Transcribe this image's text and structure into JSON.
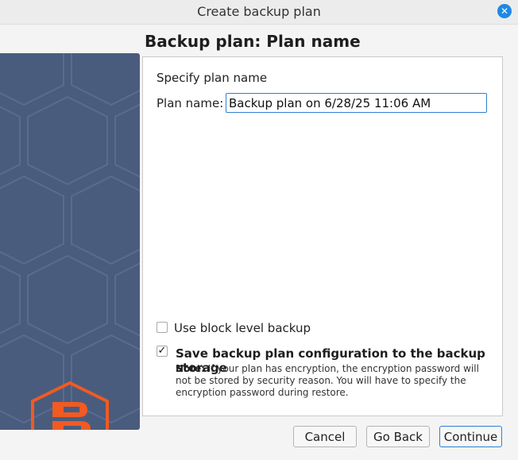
{
  "window": {
    "title": "Create backup plan",
    "close_icon": "close-icon"
  },
  "page": {
    "heading": "Backup plan: Plan name"
  },
  "form": {
    "section_label": "Specify plan name",
    "plan_name_label": "Plan name:",
    "plan_name_value": "Backup plan on 6/28/25 11:06 AM"
  },
  "options": {
    "block_level": {
      "label": "Use block level backup",
      "checked": false
    },
    "save_config": {
      "label": "Save backup plan configuration to the backup storage",
      "checked": true,
      "check_mark": "✓"
    },
    "note_label": "Note:",
    "note_text": " If your plan has encryption, the encryption password will not be stored by security reason. You will have to specify the encryption password during restore."
  },
  "buttons": {
    "cancel": "Cancel",
    "go_back": "Go Back",
    "continue": "Continue"
  },
  "colors": {
    "sidebar": "#4a5c7e",
    "logo": "#f15a22",
    "accent": "#2f7fd4"
  }
}
